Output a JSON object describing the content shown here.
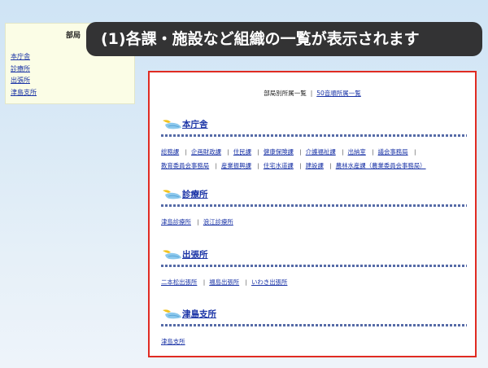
{
  "sidebar": {
    "title": "部局",
    "items": [
      {
        "label": "本庁舎"
      },
      {
        "label": "診療所"
      },
      {
        "label": "出張所"
      },
      {
        "label": "津島支所"
      }
    ]
  },
  "banner": {
    "text": "(1)各課・施設など組織の一覧が表示されます"
  },
  "top_links": [
    {
      "label": "部局別所属一覧"
    },
    {
      "label": "50音順所属一覧"
    }
  ],
  "sections": [
    {
      "title": "本庁舎",
      "links": [
        "総務課",
        "企画財政課",
        "住民課",
        "健康保険課",
        "介護福祉課",
        "出納室",
        "議会事務局",
        "教育委員会事務局",
        "産業振興課",
        "住宅水道課",
        "建設課",
        "農林水産課（農業委員会事務局）"
      ]
    },
    {
      "title": "診療所",
      "links": [
        "津島診療所",
        "浪江診療所"
      ]
    },
    {
      "title": "出張所",
      "links": [
        "二本松出張所",
        "福島出張所",
        "いわき出張所"
      ]
    },
    {
      "title": "津島支所",
      "links": [
        "津島支所"
      ]
    }
  ],
  "colors": {
    "link": "#1a33a6",
    "panel_border": "#e02b22",
    "banner_bg": "#333334",
    "sidebar_bg": "#fbfde6"
  }
}
